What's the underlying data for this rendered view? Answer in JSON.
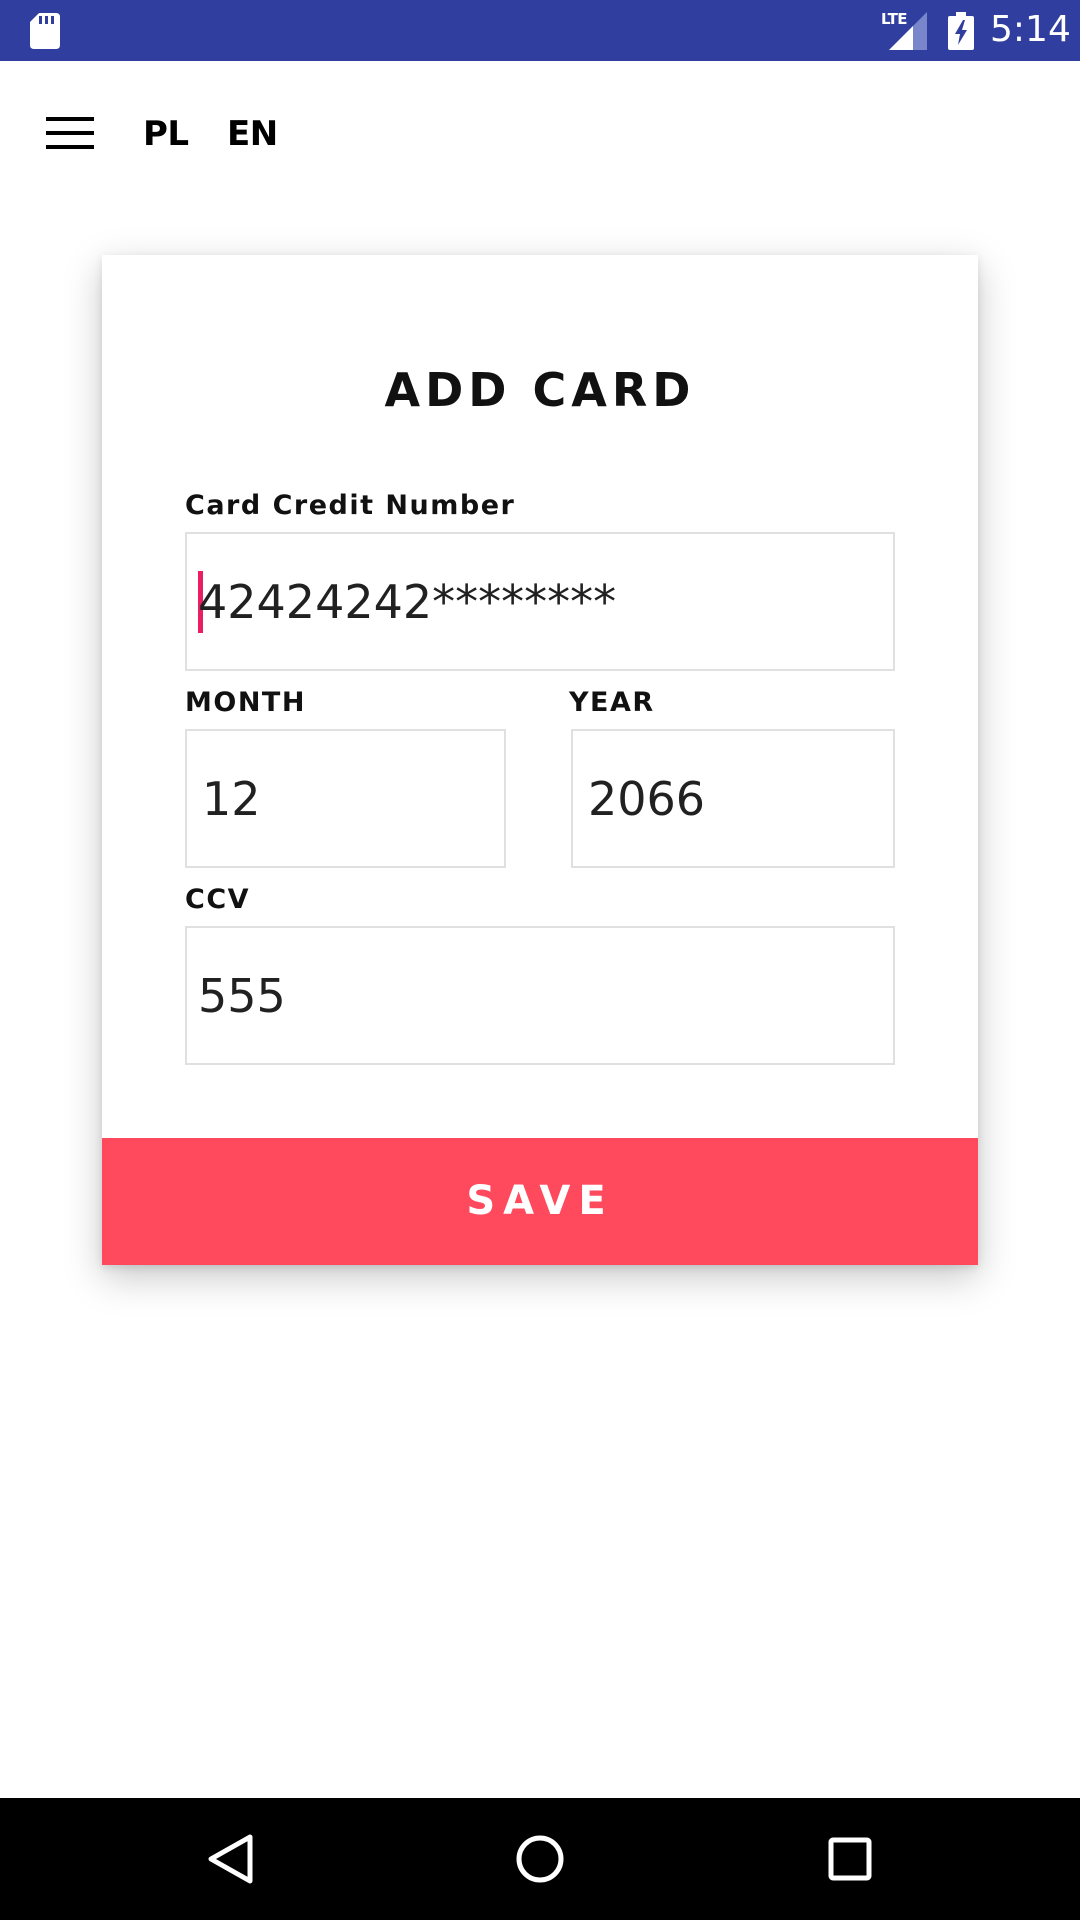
{
  "status_bar": {
    "time": "5:14",
    "network": "LTE",
    "background_color": "#303f9f",
    "icons": [
      "sd-card-icon",
      "signal-icon",
      "battery-charging-icon"
    ]
  },
  "toolbar": {
    "menu_icon": "hamburger-menu-icon",
    "languages": [
      "PL",
      "EN"
    ]
  },
  "form": {
    "title": "ADD CARD",
    "card_number": {
      "label": "Card Credit Number",
      "value": "42424242********"
    },
    "month": {
      "label": "MONTH",
      "value": "12"
    },
    "separator": "/",
    "year": {
      "label": "YEAR",
      "value": "2066"
    },
    "ccv": {
      "label": "CCV",
      "value": "555"
    },
    "save_label": "SAVE"
  },
  "colors": {
    "accent": "#ff4a5e",
    "cursor": "#e91e63",
    "field_border": "#e0e0e0"
  },
  "nav_bar": {
    "icons": [
      "back-icon",
      "home-icon",
      "recents-icon"
    ]
  }
}
